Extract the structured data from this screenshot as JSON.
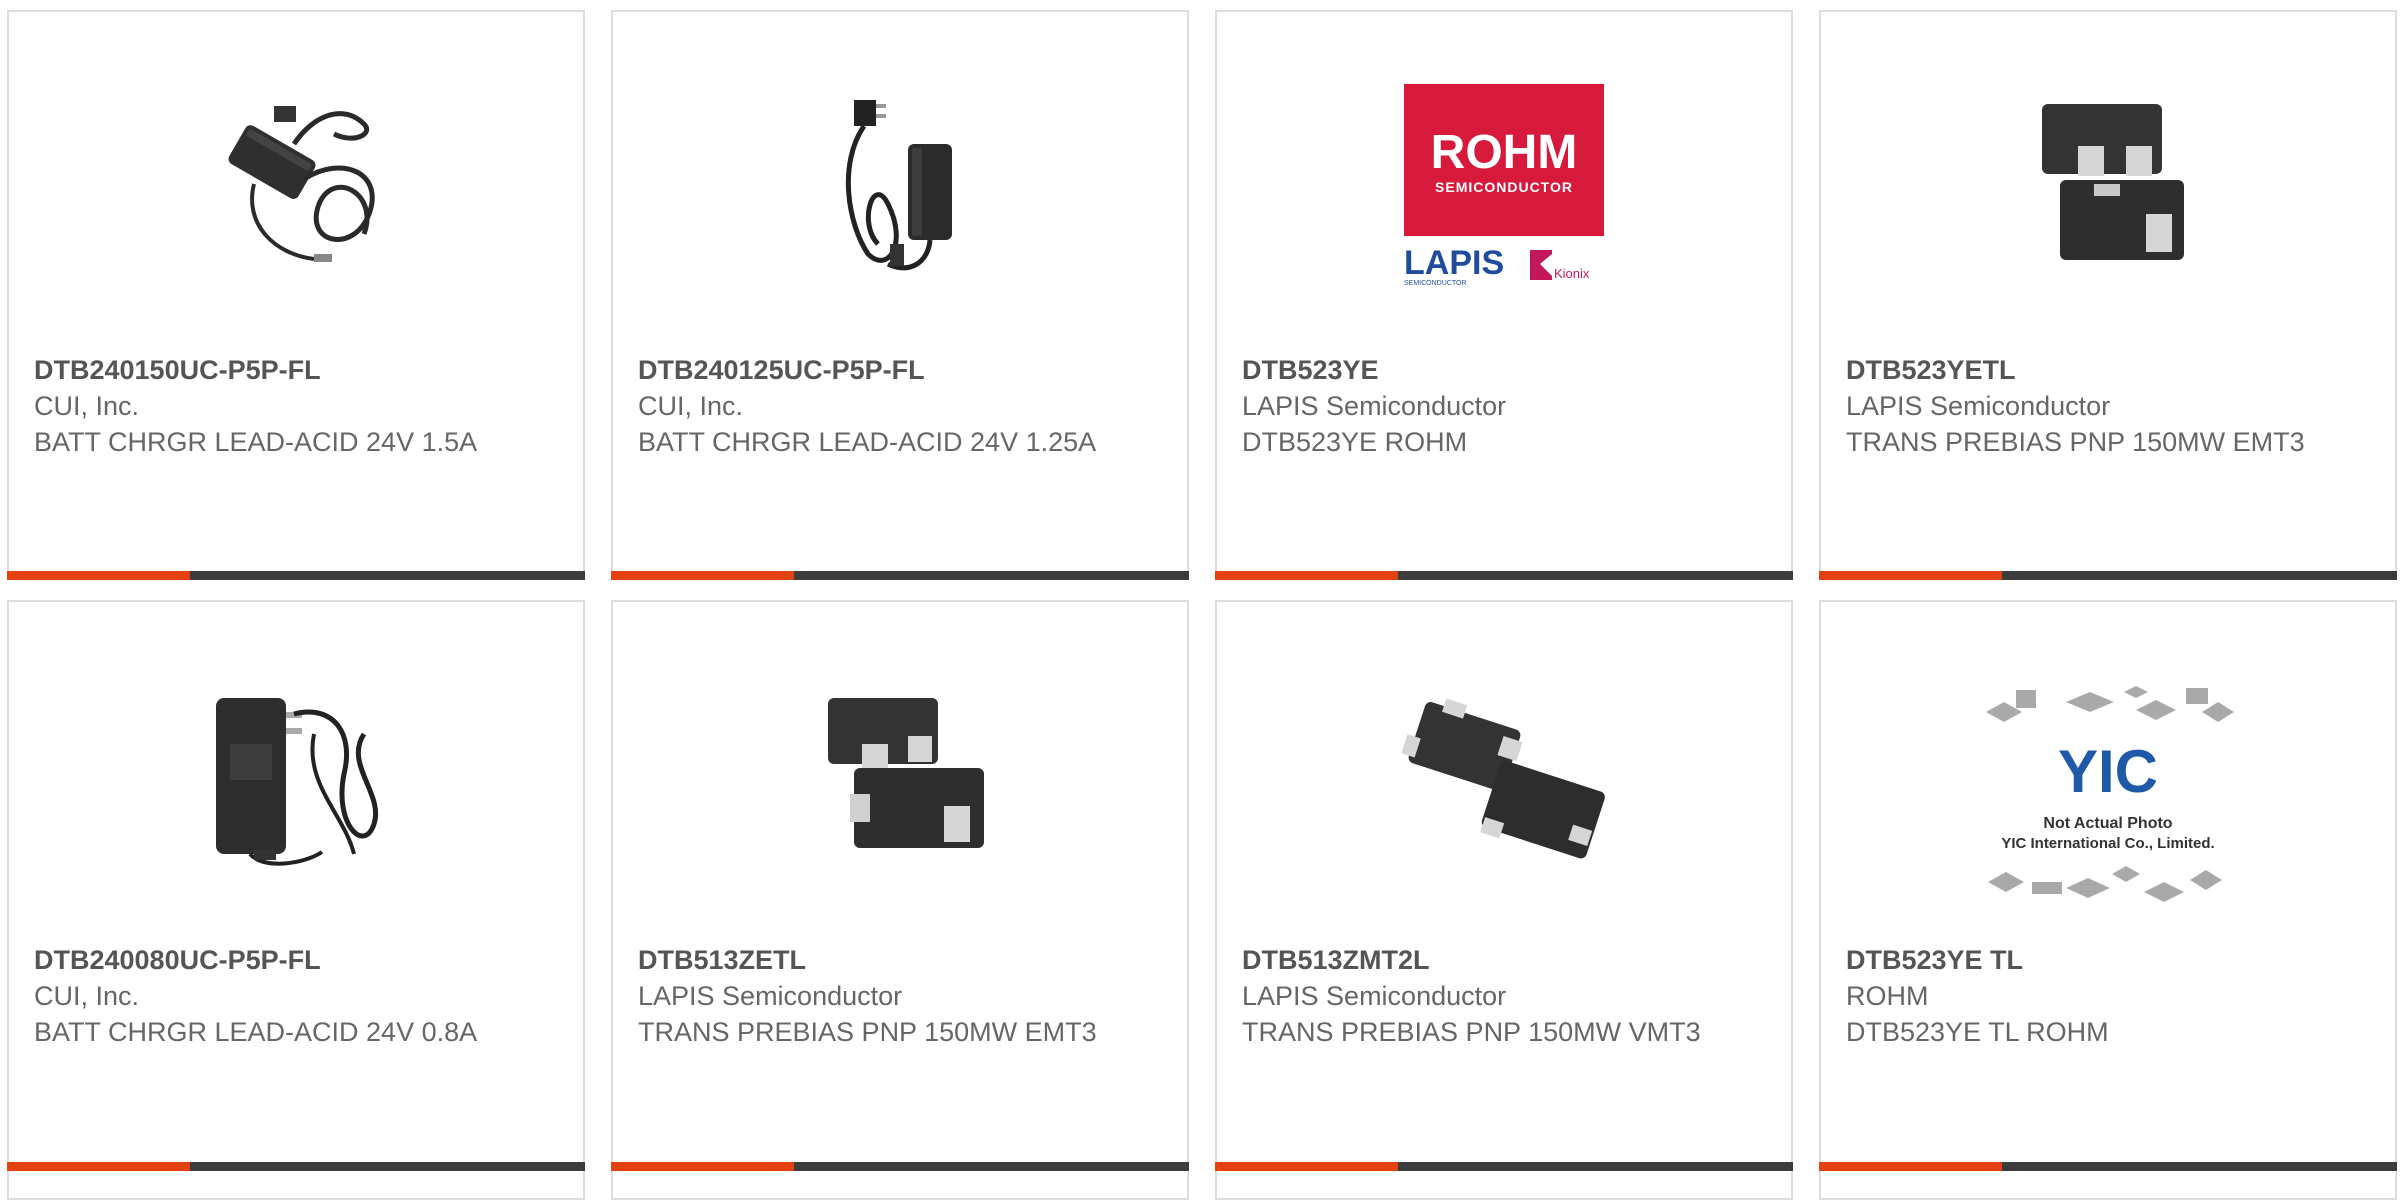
{
  "products": [
    {
      "part": "DTB240150UC-P5P-FL",
      "maker": "CUI, Inc.",
      "desc": "BATT CHRGR LEAD-ACID 24V 1.5A",
      "image": "power-adapter-coiled-icon"
    },
    {
      "part": "DTB240125UC-P5P-FL",
      "maker": "CUI, Inc.",
      "desc": "BATT CHRGR LEAD-ACID 24V 1.25A",
      "image": "power-adapter-plug-icon"
    },
    {
      "part": "DTB523YE",
      "maker": "LAPIS Semiconductor",
      "desc": "DTB523YE ROHM",
      "image": "rohm-lapis-logo"
    },
    {
      "part": "DTB523YETL",
      "maker": "LAPIS Semiconductor",
      "desc": "TRANS PREBIAS PNP 150MW EMT3",
      "image": "sot-transistor-icon"
    },
    {
      "part": "DTB240080UC-P5P-FL",
      "maker": "CUI, Inc.",
      "desc": "BATT CHRGR LEAD-ACID 24V 0.8A",
      "image": "wall-adapter-icon"
    },
    {
      "part": "DTB513ZETL",
      "maker": "LAPIS Semiconductor",
      "desc": "TRANS PREBIAS PNP 150MW EMT3",
      "image": "sot-transistor-icon"
    },
    {
      "part": "DTB513ZMT2L",
      "maker": "LAPIS Semiconductor",
      "desc": "TRANS PREBIAS PNP 150MW VMT3",
      "image": "vmt-transistor-icon"
    },
    {
      "part": "DTB523YE TL",
      "maker": "ROHM",
      "desc": "DTB523YE TL ROHM",
      "image": "not-actual-photo-placeholder"
    }
  ],
  "logos": {
    "rohm": "ROHM",
    "rohm_sub": "SEMICONDUCTOR",
    "lapis": "LAPIS",
    "lapis_sub": "SEMICONDUCTOR",
    "kionix": "Kionix",
    "yic": "YIC",
    "placeholder_line1": "Not Actual Photo",
    "placeholder_line2": "YIC International Co., Limited."
  },
  "colors": {
    "accent": "#e34112",
    "bar": "#3c3c3c",
    "rohm_red": "#d7193b",
    "lapis_blue": "#1d4d9b"
  }
}
